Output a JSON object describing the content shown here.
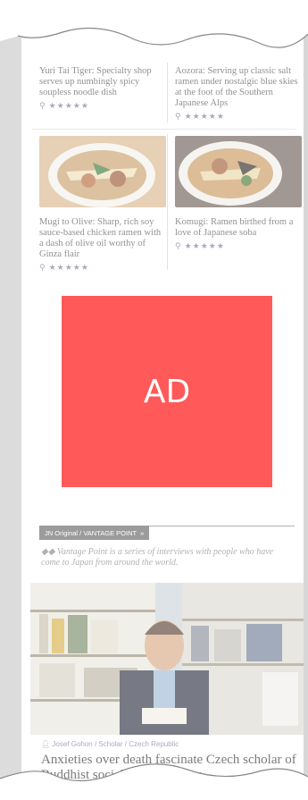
{
  "articles": [
    {
      "desc": "Yuri Tai Tiger: Specialty shop serves up numbingly spicy soupless noodle dish",
      "rating": "★★★★★",
      "image_icon": "ramen-bowl-image"
    },
    {
      "desc": "Aozora: Serving up classic salt ramen under nostalgic blue skies at the foot of the Southern Japanese Alps",
      "rating": "★★★★★",
      "image_icon": "ramen-bowl-image"
    },
    {
      "desc": "Mugi to Olive: Sharp, rich soy sauce-based chicken ramen with a dash of olive oil worthy of Ginza flair",
      "rating": "★★★★★",
      "image_icon": "ramen-bowl-image"
    },
    {
      "desc": "Komugi: Ramen birthed from a love of Japanese soba",
      "rating": "★★★★★",
      "image_icon": "ramen-bowl-image"
    }
  ],
  "ad": {
    "label": "AD",
    "color": "#ff0000"
  },
  "vantage": {
    "badge": "JN Original / VANTAGE POINT",
    "badge_arrow": "»",
    "desc_marker": "◆◆",
    "desc": "Vantage Point is a series of interviews with people who have come to Japan from around the world.",
    "meta": "Josef Gohon / Scholar / Czech Republic",
    "title": "Anxieties over death fascinate Czech scholar of Buddhist social work in Japan"
  },
  "colors": {
    "accent": "#7a7f9a",
    "badge_bg": "#666666"
  }
}
